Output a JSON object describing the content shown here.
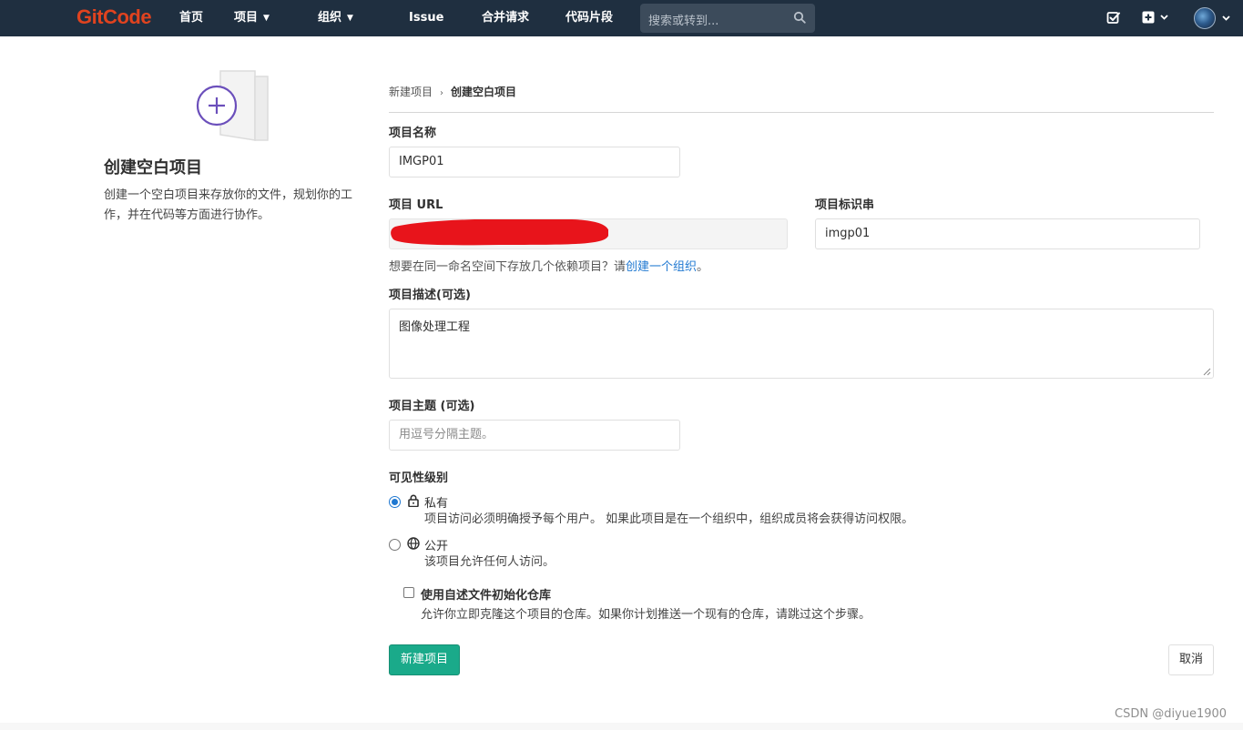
{
  "navbar": {
    "logo": "GitCode",
    "items": [
      {
        "label": "首页",
        "has_caret": false
      },
      {
        "label": "项目",
        "has_caret": true
      },
      {
        "label": "组织",
        "has_caret": true
      },
      {
        "label": "Issue",
        "has_caret": false
      },
      {
        "label": "合并请求",
        "has_caret": false
      },
      {
        "label": "代码片段",
        "has_caret": false
      }
    ],
    "search_placeholder": "搜索或转到...",
    "icons": [
      "search-icon",
      "todo-icon",
      "plus-square-icon",
      "chevron-down-icon",
      "avatar"
    ],
    "background_color": "#1f2f40",
    "logo_color": "#e0431f"
  },
  "intro": {
    "title": "创建空白项目",
    "description": "创建一个空白项目来存放你的文件，规划你的工作，并在代码等方面进行协作。"
  },
  "breadcrumb": {
    "parent": "新建项目",
    "current": "创建空白项目"
  },
  "form": {
    "project_name": {
      "label": "项目名称",
      "value": "IMGP01"
    },
    "project_url": {
      "label": "项目 URL",
      "value_redacted": true
    },
    "project_slug": {
      "label": "项目标识串",
      "value": "imgp01"
    },
    "namespace_help": {
      "text": "想要在同一命名空间下存放几个依赖项目？请",
      "link": "创建一个组织",
      "suffix": "。"
    },
    "description": {
      "label": "项目描述(可选)",
      "value": "图像处理工程"
    },
    "topics": {
      "label": "项目主题 (可选)",
      "placeholder": "用逗号分隔主题。"
    },
    "visibility": {
      "label": "可见性级别",
      "options": [
        {
          "title": "私有",
          "icon": "lock-icon",
          "description": "项目访问必须明确授予每个用户。 如果此项目是在一个组织中，组织成员将会获得访问权限。",
          "checked": true
        },
        {
          "title": "公开",
          "icon": "globe-icon",
          "description": "该项目允许任何人访问。",
          "checked": false
        }
      ]
    },
    "init_readme": {
      "label": "使用自述文件初始化仓库",
      "description": "允许你立即克隆这个项目的仓库。如果你计划推送一个现有的仓库，请跳过这个步骤。",
      "checked": false
    },
    "submit_label": "新建项目",
    "cancel_label": "取消"
  },
  "colors": {
    "primary_button": "#1aaa8a",
    "link": "#1f78d1",
    "redaction": "#e8141b"
  },
  "watermark": "CSDN @diyue1900"
}
